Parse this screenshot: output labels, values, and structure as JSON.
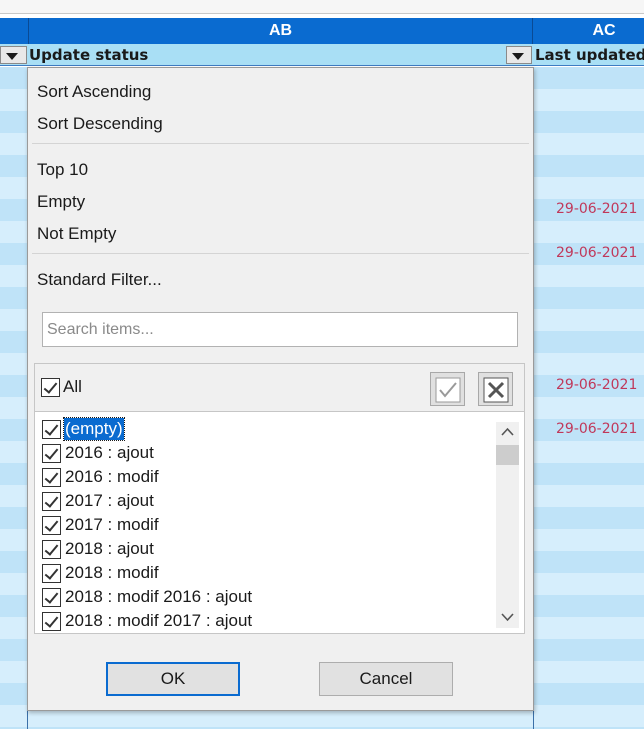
{
  "spreadsheet": {
    "columns": [
      {
        "letter": "AB"
      },
      {
        "letter": "AC"
      }
    ],
    "headers": {
      "ab": "Update status",
      "ac": "Last updated"
    },
    "dates": [
      {
        "text": "29-06-2021",
        "row": 6
      },
      {
        "text": "29-06-2021",
        "row": 8
      },
      {
        "text": "29-06-2021",
        "row": 14
      },
      {
        "text": "29-06-2021",
        "row": 16
      }
    ]
  },
  "popup": {
    "menu": {
      "sort_asc": "Sort Ascending",
      "sort_desc": "Sort Descending",
      "top10": "Top 10",
      "empty": "Empty",
      "not_empty": "Not Empty",
      "standard_filter": "Standard Filter..."
    },
    "search": {
      "placeholder": "Search items..."
    },
    "all_label": "All",
    "items": [
      {
        "label": "(empty)",
        "checked": true,
        "selected": true
      },
      {
        "label": "2016 : ajout",
        "checked": true
      },
      {
        "label": "2016 : modif",
        "checked": true
      },
      {
        "label": "2017 : ajout",
        "checked": true
      },
      {
        "label": "2017 : modif",
        "checked": true
      },
      {
        "label": "2018 : ajout",
        "checked": true
      },
      {
        "label": "2018 : modif",
        "checked": true
      },
      {
        "label": "2018 : modif 2016 : ajout",
        "checked": true
      },
      {
        "label": "2018 : modif 2017 : ajout",
        "checked": true
      }
    ],
    "buttons": {
      "ok": "OK",
      "cancel": "Cancel"
    }
  },
  "colors": {
    "header_blue": "#0a6bd0",
    "header_row": "#a9dff5",
    "date_text": "#c0385a"
  }
}
